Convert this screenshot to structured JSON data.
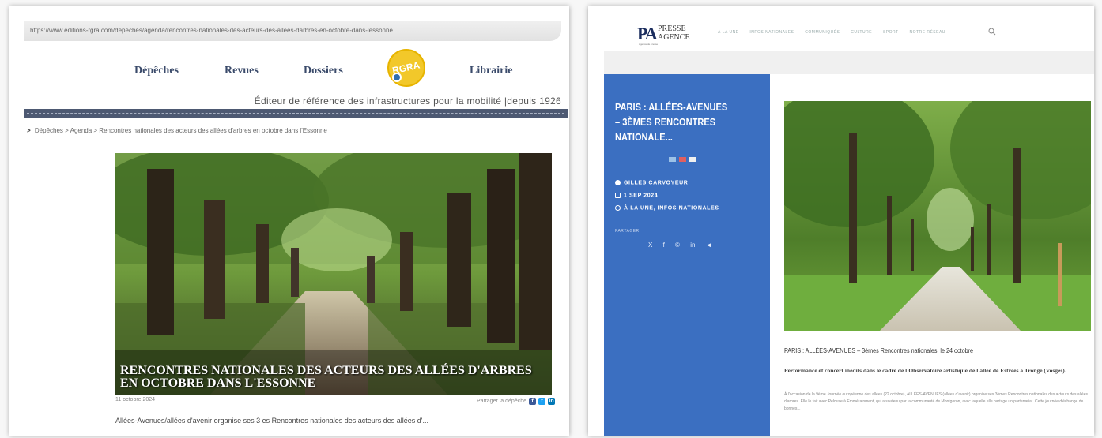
{
  "left": {
    "url": "https://www.editions-rgra.com/depeches/agenda/rencontres-nationales-des-acteurs-des-allees-darbres-en-octobre-dans-lessonne",
    "nav": [
      "Dépêches",
      "Revues",
      "Dossiers",
      "Librairie"
    ],
    "logo_text": "RGRA",
    "tagline": "Éditeur de référence des infrastructures pour la mobilité |depuis 1926",
    "breadcrumb": "Dépêches > Agenda > Rencontres nationales des acteurs des allées d'arbres en octobre dans l'Essonne",
    "caption": "Rencontres nationales des acteurs des allées d'arbres en octobre dans l'Essonne",
    "date": "11 octobre 2024",
    "share_label": "Partager la dépêche",
    "excerpt": "Allées-Avenues/allées d'avenir organise ses 3 es Rencontres nationales des acteurs des allées d'..."
  },
  "right": {
    "logo_pa": "PA",
    "logo_word1": "PRESSE",
    "logo_word2": "AGENCE",
    "logo_sub": "Agence de presse",
    "menu": [
      "À LA UNE",
      "INFOS NATIONALES",
      "COMMUNIQUÉS",
      "CULTURE",
      "SPORT",
      "NOTRE RÉSEAU"
    ],
    "sidebar_title": "PARIS : ALLÉES-AVENUES – 3ÈMES RENCONTRES NATIONALE...",
    "author": "GILLES CARVOYEUR",
    "date": "1 SEP 2024",
    "categories": "À LA UNE, INFOS NATIONALES",
    "partager": "PARTAGER",
    "social": [
      "X",
      "f",
      "©",
      "in",
      "◄"
    ],
    "headline": "PARIS : ALLÉES-AVENUES – 3èmes Rencontres nationales, le 24 octobre",
    "lead": "Performance et concert inédits dans le cadre de l'Observatoire artistique de l'allée de Estrées à Tronge (Vosges).",
    "body": "À l'occasion de la 9ème Journée européenne des allées (22 octobre), ALLÉES-AVENUES (allées d'avenir) organise ses 3èmes Rencontres nationales des acteurs des allées d'arbres. Elle le fait avec Pelouse à Emmérainment, qui a soutenu par la communauté de Montgeron, avec laquelle elle partage un partenariat. Cette journée d'échange de bonnes..."
  },
  "colors": {
    "sidebar_blue": "#3b6fc1",
    "divider": "#4d5972",
    "nav_text": "#3a4a6a",
    "logo_yellow": "#f2c82a"
  }
}
